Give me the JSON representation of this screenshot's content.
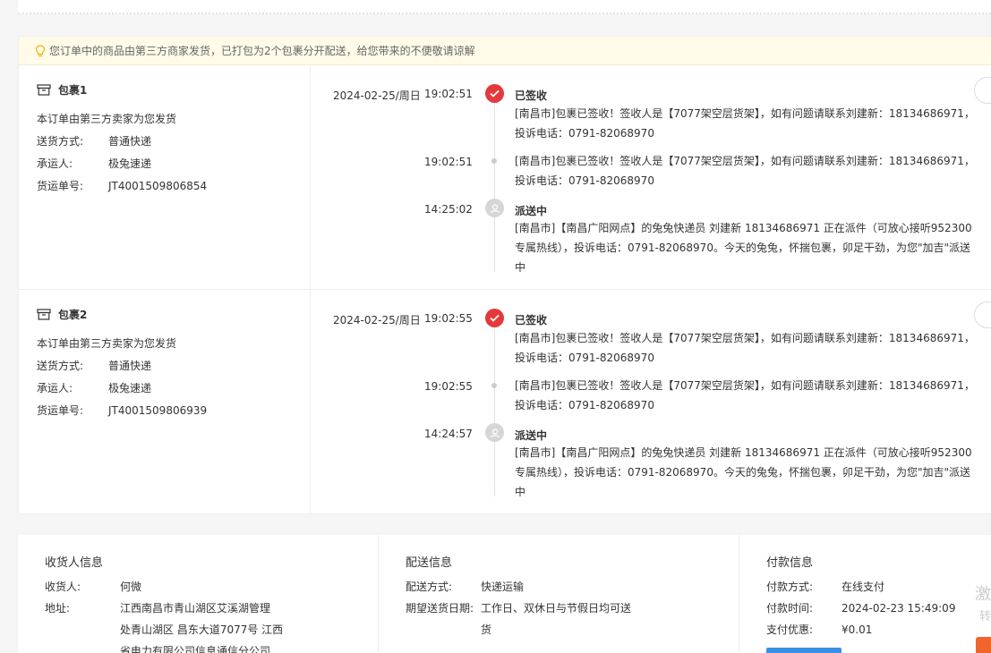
{
  "notice": "您订单中的商品由第三方商家发货，已打包为2个包裹分开配送，给您带来的不便敬请谅解",
  "packages": [
    {
      "title": "包裹1",
      "note": "本订单由第三方卖家为您发货",
      "ship_method_label": "送货方式:",
      "ship_method": "普通快递",
      "carrier_label": "承运人:",
      "carrier": "极兔速递",
      "tracking_label": "货运单号:",
      "tracking": "JT4001509806854",
      "events": [
        {
          "date": "2024-02-25/周日",
          "time": "19:02:51",
          "status": "已签收",
          "desc": "[南昌市]包裹已签收！签收人是【7077架空层货架】，如有问题请联系刘建新：18134686971，投诉电话：0791-82068970"
        },
        {
          "time": "19:02:51",
          "desc": "[南昌市]包裹已签收！签收人是【7077架空层货架】，如有问题请联系刘建新：18134686971，投诉电话：0791-82068970"
        },
        {
          "time": "14:25:02",
          "status": "派送中",
          "desc": "[南昌市]【南昌广阳网点】的兔兔快递员 刘建新 18134686971 正在派件（可放心接听952300专属热线），投诉电话：0791-82068970。今天的兔兔，怀揣包裹，卯足干劲，为您\"加吉\"派送中"
        }
      ]
    },
    {
      "title": "包裹2",
      "note": "本订单由第三方卖家为您发货",
      "ship_method_label": "送货方式:",
      "ship_method": "普通快递",
      "carrier_label": "承运人:",
      "carrier": "极兔速递",
      "tracking_label": "货运单号:",
      "tracking": "JT4001509806939",
      "events": [
        {
          "date": "2024-02-25/周日",
          "time": "19:02:55",
          "status": "已签收",
          "desc": "[南昌市]包裹已签收！签收人是【7077架空层货架】，如有问题请联系刘建新：18134686971，投诉电话：0791-82068970"
        },
        {
          "time": "19:02:55",
          "desc": "[南昌市]包裹已签收！签收人是【7077架空层货架】，如有问题请联系刘建新：18134686971，投诉电话：0791-82068970"
        },
        {
          "time": "14:24:57",
          "status": "派送中",
          "desc": "[南昌市]【南昌广阳网点】的兔兔快递员 刘建新 18134686971 正在派件（可放心接听952300专属热线），投诉电话：0791-82068970。今天的兔兔，怀揣包裹，卯足干劲，为您\"加吉\"派送中"
        }
      ]
    }
  ],
  "receiver": {
    "title": "收货人信息",
    "name_label": "收货人:",
    "name": "何微",
    "address_label": "地址:",
    "address_line1": "江西南昌市青山湖区艾溪湖管理",
    "address_line2": "处青山湖区 昌东大道7077号 江西",
    "address_line3": "省电力有限公司信息通信分公司"
  },
  "delivery": {
    "title": "配送信息",
    "method_label": "配送方式:",
    "method": "快递运输",
    "expected_label": "期望送货日期:",
    "expected_line1": "工作日、双休日与节假日均可送",
    "expected_line2": "货"
  },
  "payment": {
    "title": "付款信息",
    "method_label": "付款方式:",
    "method": "在线支付",
    "time_label": "付款时间:",
    "time": "2024-02-23 15:49:09",
    "discount_label": "支付优惠:",
    "discount": "¥0.01"
  },
  "edge": {
    "text1": "激",
    "text2": "转"
  },
  "colors": {
    "accent_red": "#e4393c",
    "notice_bg": "#fffbe8"
  }
}
